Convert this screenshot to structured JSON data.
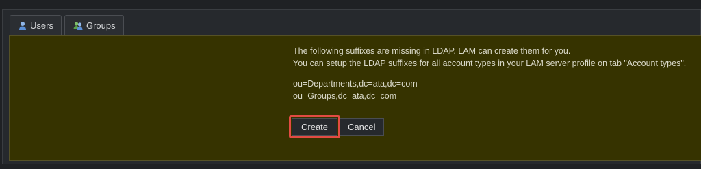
{
  "tabs": [
    {
      "label": "Users",
      "icon": "user-icon"
    },
    {
      "label": "Groups",
      "icon": "group-icon"
    }
  ],
  "message": {
    "line1": "The following suffixes are missing in LDAP. LAM can create them for you.",
    "line2": "You can setup the LDAP suffixes for all account types in your LAM server profile on tab \"Account types\"."
  },
  "suffixes": [
    "ou=Departments,dc=ata,dc=com",
    "ou=Groups,dc=ata,dc=com"
  ],
  "buttons": {
    "create_label": "Create",
    "cancel_label": "Cancel"
  },
  "colors": {
    "panel_bg": "#363300",
    "highlight": "#e24b43"
  }
}
